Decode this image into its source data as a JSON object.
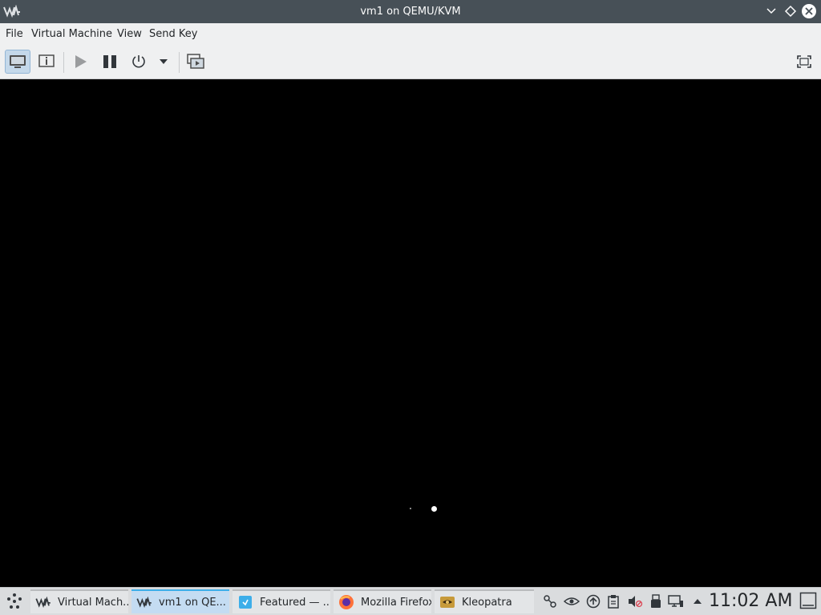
{
  "window": {
    "title": "vm1 on QEMU/KVM"
  },
  "menubar": {
    "items": [
      "File",
      "Virtual Machine",
      "View",
      "Send Key"
    ]
  },
  "toolbar": {
    "buttons": [
      {
        "name": "console",
        "icon": "monitor-icon",
        "active": true
      },
      {
        "name": "details",
        "icon": "info-icon"
      },
      {
        "name": "run",
        "icon": "play-icon"
      },
      {
        "name": "pause",
        "icon": "pause-icon"
      },
      {
        "name": "shutdown",
        "icon": "power-icon"
      },
      {
        "name": "shutdown-menu",
        "icon": "dropdown-arrow-icon"
      },
      {
        "name": "snapshots",
        "icon": "snapshots-icon"
      },
      {
        "name": "fullscreen",
        "icon": "fullscreen-icon"
      }
    ]
  },
  "taskbar": {
    "tasks": [
      {
        "label": "Virtual Mach...",
        "icon": "virt-manager-icon",
        "active": false
      },
      {
        "label": "vm1 on QE...",
        "icon": "virt-manager-icon",
        "active": true
      },
      {
        "label": "Featured — ...",
        "icon": "discover-icon",
        "active": false
      },
      {
        "label": "Mozilla Firefox",
        "icon": "firefox-icon",
        "active": false
      },
      {
        "label": "Kleopatra",
        "icon": "kleopatra-icon",
        "active": false
      }
    ],
    "tray_icons": [
      "kde-connect-icon",
      "vault-icon",
      "updates-icon",
      "clipboard-icon",
      "volume-muted-icon",
      "usb-device-icon",
      "network-icon",
      "expand-tray-icon"
    ],
    "clock": "11:02 AM"
  },
  "colors": {
    "titlebar": "#475057",
    "menubar": "#eff0f1",
    "taskbar": "#dadcde",
    "active_task": "#c4dcf2",
    "accent": "#3daee9",
    "console": "#000000"
  }
}
